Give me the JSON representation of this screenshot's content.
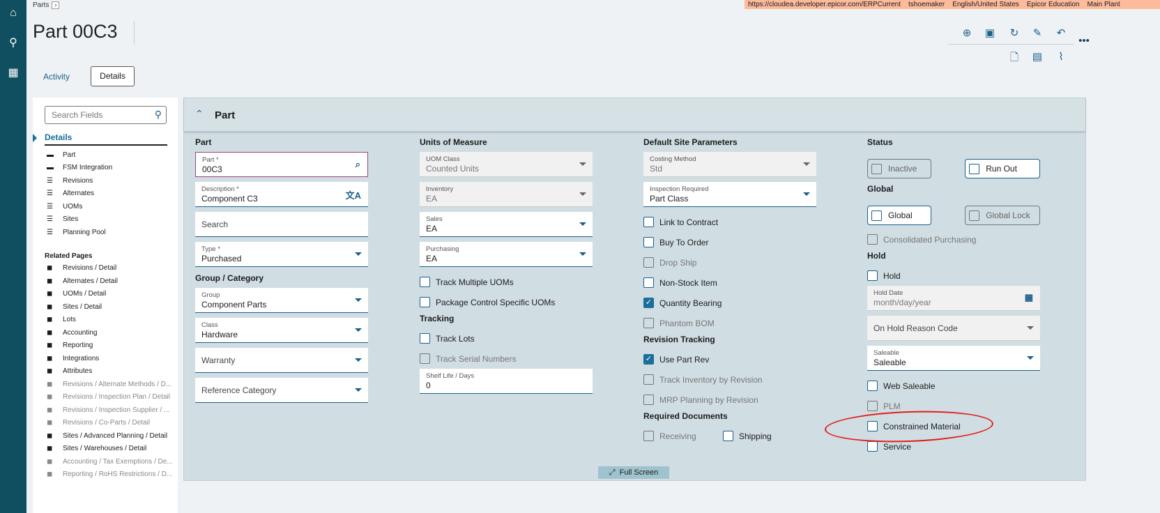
{
  "breadcrumb": {
    "label": "Parts",
    "chevron": "›"
  },
  "env": [
    "https://cloudea.developer.epicor.com/ERPCurrent",
    "tshoemaker",
    "English/United States",
    "Epicor Education",
    "Main Plant"
  ],
  "title": "Part 00C3",
  "rail": {
    "icons": [
      "home-icon",
      "search-icon",
      "apps-icon"
    ]
  },
  "toolbar": {
    "icons": [
      "add-new-icon",
      "save-icon",
      "refresh-icon",
      "clear-icon",
      "undo-icon",
      "more-icon",
      "new-document-icon",
      "preview-icon",
      "attachment-icon"
    ]
  },
  "tabs": {
    "activity": "Activity",
    "details": "Details"
  },
  "sidebar": {
    "search_placeholder": "Search Fields",
    "details_label": "Details",
    "items": [
      {
        "label": "Part",
        "icon": "card"
      },
      {
        "label": "FSM Integration",
        "icon": "card"
      },
      {
        "label": "Revisions",
        "icon": "list"
      },
      {
        "label": "Alternates",
        "icon": "list"
      },
      {
        "label": "UOMs",
        "icon": "list"
      },
      {
        "label": "Sites",
        "icon": "list"
      },
      {
        "label": "Planning Pool",
        "icon": "list"
      }
    ],
    "related_label": "Related Pages",
    "related": [
      {
        "label": "Revisions / Detail",
        "enabled": true
      },
      {
        "label": "Alternates / Detail",
        "enabled": true
      },
      {
        "label": "UOMs / Detail",
        "enabled": true
      },
      {
        "label": "Sites / Detail",
        "enabled": true
      },
      {
        "label": "Lots",
        "enabled": true
      },
      {
        "label": "Accounting",
        "enabled": true
      },
      {
        "label": "Reporting",
        "enabled": true
      },
      {
        "label": "Integrations",
        "enabled": true
      },
      {
        "label": "Attributes",
        "enabled": true
      },
      {
        "label": "Revisions / Alternate Methods / D...",
        "enabled": false
      },
      {
        "label": "Revisions / Inspection Plan / Detail",
        "enabled": false
      },
      {
        "label": "Revisions / Inspection Supplier / ...",
        "enabled": false
      },
      {
        "label": "Revisions / Co-Parts / Detail",
        "enabled": false
      },
      {
        "label": "Sites / Advanced Planning / Detail",
        "enabled": true
      },
      {
        "label": "Sites / Warehouses / Detail",
        "enabled": true
      },
      {
        "label": "Accounting / Tax Exemptions / De...",
        "enabled": false
      },
      {
        "label": "Reporting / RoHS Restrictions / D...",
        "enabled": false
      }
    ]
  },
  "panel": {
    "title": "Part",
    "fullscreen": "Full Screen"
  },
  "columns": [
    [
      {
        "t": "h",
        "text": "Part"
      },
      {
        "t": "f",
        "label": "Part *",
        "value": "00C3",
        "icon": "part-search-icon",
        "active": true
      },
      {
        "t": "f",
        "label": "Description *",
        "value": "Component C3",
        "icon": "translate-icon"
      },
      {
        "t": "big",
        "label": "Search"
      },
      {
        "t": "s",
        "label": "Type *",
        "value": "Purchased"
      },
      {
        "t": "h",
        "text": "Group / Category"
      },
      {
        "t": "s",
        "label": "Group",
        "value": "Component Parts"
      },
      {
        "t": "s",
        "label": "Class",
        "value": "Hardware"
      },
      {
        "t": "sbig",
        "label": "Warranty"
      },
      {
        "t": "sbig",
        "label": "Reference Category"
      }
    ],
    [
      {
        "t": "h",
        "text": "Units of Measure"
      },
      {
        "t": "s",
        "label": "UOM Class",
        "value": "Counted Units",
        "disabled": true
      },
      {
        "t": "s",
        "label": "Inventory",
        "value": "EA",
        "disabled": true
      },
      {
        "t": "s",
        "label": "Sales",
        "value": "EA"
      },
      {
        "t": "s",
        "label": "Purchasing",
        "value": "EA"
      },
      {
        "t": "c",
        "label": "Track Multiple UOMs",
        "checked": false
      },
      {
        "t": "c",
        "label": "Package Control Specific UOMs",
        "checked": false
      },
      {
        "t": "h",
        "text": "Tracking"
      },
      {
        "t": "c",
        "label": "Track Lots",
        "checked": false
      },
      {
        "t": "c",
        "label": "Track Serial Numbers",
        "checked": false,
        "disabled": true
      },
      {
        "t": "f",
        "label": "Shelf Life / Days",
        "value": "0"
      }
    ],
    [
      {
        "t": "h",
        "text": "Default Site Parameters"
      },
      {
        "t": "s",
        "label": "Costing Method",
        "value": "Std",
        "disabled": true
      },
      {
        "t": "s",
        "label": "Inspection Required",
        "value": "Part Class"
      },
      {
        "t": "c",
        "label": "Link to Contract",
        "checked": false
      },
      {
        "t": "c",
        "label": "Buy To Order",
        "checked": false
      },
      {
        "t": "c",
        "label": "Drop Ship",
        "checked": false,
        "disabled": true
      },
      {
        "t": "c",
        "label": "Non-Stock Item",
        "checked": false
      },
      {
        "t": "c",
        "label": "Quantity Bearing",
        "checked": true
      },
      {
        "t": "c",
        "label": "Phantom BOM",
        "checked": false,
        "disabled": true
      },
      {
        "t": "h",
        "text": "Revision Tracking"
      },
      {
        "t": "c",
        "label": "Use Part Rev",
        "checked": true
      },
      {
        "t": "c",
        "label": "Track Inventory by Revision",
        "checked": false,
        "disabled": true
      },
      {
        "t": "c",
        "label": "MRP Planning by Revision",
        "checked": false,
        "disabled": true
      },
      {
        "t": "h",
        "text": "Required Documents"
      },
      {
        "t": "crow",
        "items": [
          {
            "label": "Receiving",
            "checked": false,
            "disabled": true
          },
          {
            "label": "Shipping",
            "checked": false
          }
        ]
      }
    ],
    [
      {
        "t": "h",
        "text": "Status"
      },
      {
        "t": "brow",
        "items": [
          {
            "label": "Inactive",
            "disabled": true
          },
          {
            "label": "Run Out"
          }
        ]
      },
      {
        "t": "h",
        "text": "Global"
      },
      {
        "t": "brow",
        "items": [
          {
            "label": "Global"
          },
          {
            "label": "Global Lock",
            "disabled": true
          }
        ]
      },
      {
        "t": "c",
        "label": "Consolidated Purchasing",
        "checked": false,
        "disabled": true
      },
      {
        "t": "h",
        "text": "Hold"
      },
      {
        "t": "c",
        "label": "Hold",
        "checked": false
      },
      {
        "t": "f",
        "label": "Hold Date",
        "value": "month/day/year",
        "icon": "calendar-icon",
        "disabled": true
      },
      {
        "t": "sbig",
        "label": "On Hold Reason Code",
        "disabled": true
      },
      {
        "t": "s",
        "label": "Saleable",
        "value": "Saleable"
      },
      {
        "t": "c",
        "label": "Web Saleable",
        "checked": false
      },
      {
        "t": "c",
        "label": "PLM",
        "checked": false,
        "disabled": true
      },
      {
        "t": "c",
        "label": "Constrained Material",
        "checked": false,
        "highlighted": true
      },
      {
        "t": "c",
        "label": "Service",
        "checked": false
      }
    ]
  ],
  "annotation": {
    "color": "#e31b1b"
  }
}
